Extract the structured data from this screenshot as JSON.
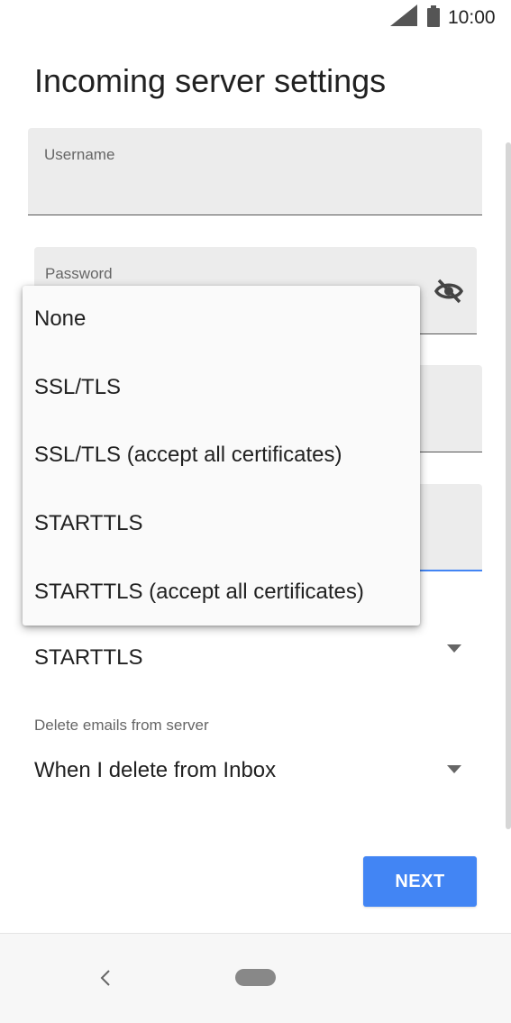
{
  "status_bar": {
    "time": "10:00",
    "icons": [
      "signal-icon",
      "battery-icon"
    ]
  },
  "page": {
    "title": "Incoming server settings"
  },
  "fields": {
    "username": {
      "label": "Username",
      "value": ""
    },
    "password": {
      "label": "Password",
      "value": "",
      "toggle_icon": "eye-off-icon"
    },
    "server": {
      "label": "",
      "value": ""
    },
    "port": {
      "label": "",
      "value": ""
    }
  },
  "security_type": {
    "selected": "STARTTLS",
    "icon": "caret-down-icon"
  },
  "delete_emails": {
    "label": "Delete emails from server",
    "selected": "When I delete from Inbox",
    "icon": "caret-down-icon"
  },
  "dropdown": {
    "options": [
      "None",
      "SSL/TLS",
      "SSL/TLS (accept all certificates)",
      "STARTTLS",
      "STARTTLS (accept all certificates)"
    ]
  },
  "actions": {
    "next_label": "NEXT"
  },
  "nav_bar": {
    "icons": [
      "back-icon",
      "home-icon"
    ]
  },
  "colors": {
    "accent": "#4285f4",
    "field_background": "#ececec",
    "menu_background": "#fafafa"
  }
}
